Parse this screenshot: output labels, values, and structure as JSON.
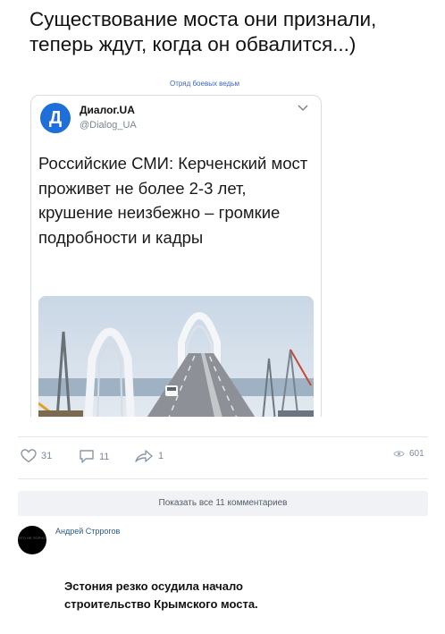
{
  "post": {
    "text": "Существование моста они признали, теперь ждут, когда он обвалится...)",
    "watermark": "Отряд боевых ведьм"
  },
  "tweet": {
    "avatar_letter": "Д",
    "account_name": "Диалог.UA",
    "handle": "@Dialog_UA",
    "headline": "Российские СМИ: Керченский мост проживет не более 2-3 лет, крушение неизбежно – громкие подробности и кадры"
  },
  "actions": {
    "likes": "31",
    "comments": "11",
    "shares": "1",
    "views": "601"
  },
  "comments": {
    "show_all_label": "Показать все 11 комментариев",
    "items": [
      {
        "author": "Андрей Стррогов",
        "avatar_text": "ЭТО НЕ ПОРНО",
        "text": "Эстония резко осудила начало строительство Крымского моста."
      }
    ]
  },
  "colors": {
    "accent": "#2a5885",
    "tweet_blue": "#1e6fd9",
    "muted": "#7a8a9a"
  }
}
